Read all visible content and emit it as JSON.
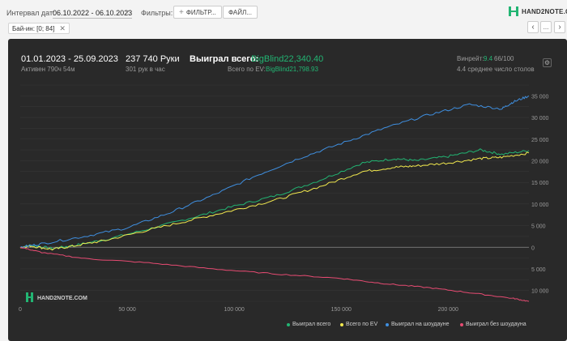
{
  "toolbar": {
    "interval_label": "Интервал дат:",
    "date_range": "06.10.2022 - 06.10.2023",
    "filters_label": "Фильтры:",
    "filter_button": "ФИЛЬТР...",
    "file_button": "ФАЙЛ...",
    "logo_text": "HAND2NOTE.COM"
  },
  "chip": {
    "label": "Бай-ин: [0; 84]"
  },
  "summary": {
    "period": "01.01.2023 - 25.09.2023",
    "active": "Активен 790ч 54м",
    "hands": "237 740 Руки",
    "hands_per_hour": "301 рук в час",
    "won_label": "Выиграл всего:",
    "won_value": "BigBlind22,340.40",
    "ev_label": "Всего по EV:",
    "ev_value": "BigBlind21,798.93",
    "wins_label": "Винрейт:",
    "wins_value": "9.4",
    "wins_unit": "66/100",
    "tables": "4.4 среднее число столов"
  },
  "watermark": "HAND2NOTE.COM",
  "colors": {
    "green": "#22b573",
    "yellow": "#f2e94e",
    "blue": "#3f8fe0",
    "pink": "#e64b72",
    "panel": "#292929"
  },
  "chart_data": {
    "type": "line",
    "x_ticks": [
      "0",
      "50 000",
      "100 000",
      "150 000",
      "200 000"
    ],
    "y_ticks": [
      "35 000",
      "30 000",
      "25 000",
      "20 000",
      "15 000",
      "10 000",
      "5 000",
      "0",
      "5 000",
      "10 000"
    ],
    "xlim": [
      0,
      237740
    ],
    "ylim": [
      -12500,
      37500
    ],
    "series": [
      {
        "name": "Выиграл всего",
        "color": "#22b573",
        "x": [
          0,
          5000,
          15000,
          25000,
          40000,
          60000,
          80000,
          100000,
          120000,
          140000,
          160000,
          175000,
          185000,
          200000,
          215000,
          225000,
          237740
        ],
        "y": [
          0,
          500,
          -300,
          400,
          1800,
          4200,
          6800,
          9500,
          12000,
          15500,
          19500,
          20500,
          20000,
          21000,
          22500,
          21500,
          22340
        ]
      },
      {
        "name": "Всего по EV",
        "color": "#f2e94e",
        "x": [
          0,
          5000,
          15000,
          25000,
          40000,
          60000,
          80000,
          100000,
          120000,
          140000,
          160000,
          175000,
          185000,
          200000,
          215000,
          225000,
          237740
        ],
        "y": [
          0,
          300,
          -500,
          300,
          1600,
          4000,
          6300,
          8600,
          11000,
          14000,
          17500,
          18500,
          18800,
          19500,
          20500,
          20800,
          21799
        ]
      },
      {
        "name": "Выиграл на шоудауне",
        "color": "#3f8fe0",
        "x": [
          0,
          10000,
          30000,
          50000,
          70000,
          90000,
          110000,
          130000,
          150000,
          170000,
          190000,
          210000,
          225000,
          230000,
          237740
        ],
        "y": [
          0,
          800,
          2500,
          4500,
          8000,
          12000,
          16500,
          20500,
          24000,
          27500,
          30500,
          33000,
          32000,
          33500,
          35000
        ]
      },
      {
        "name": "Выиграл без шоудауна",
        "color": "#e64b72",
        "x": [
          0,
          10000,
          30000,
          60000,
          90000,
          120000,
          150000,
          170000,
          190000,
          210000,
          230000,
          237740
        ],
        "y": [
          0,
          -1200,
          -2600,
          -3600,
          -5000,
          -6200,
          -7200,
          -8400,
          -9300,
          -10500,
          -11800,
          -12500
        ]
      }
    ]
  }
}
